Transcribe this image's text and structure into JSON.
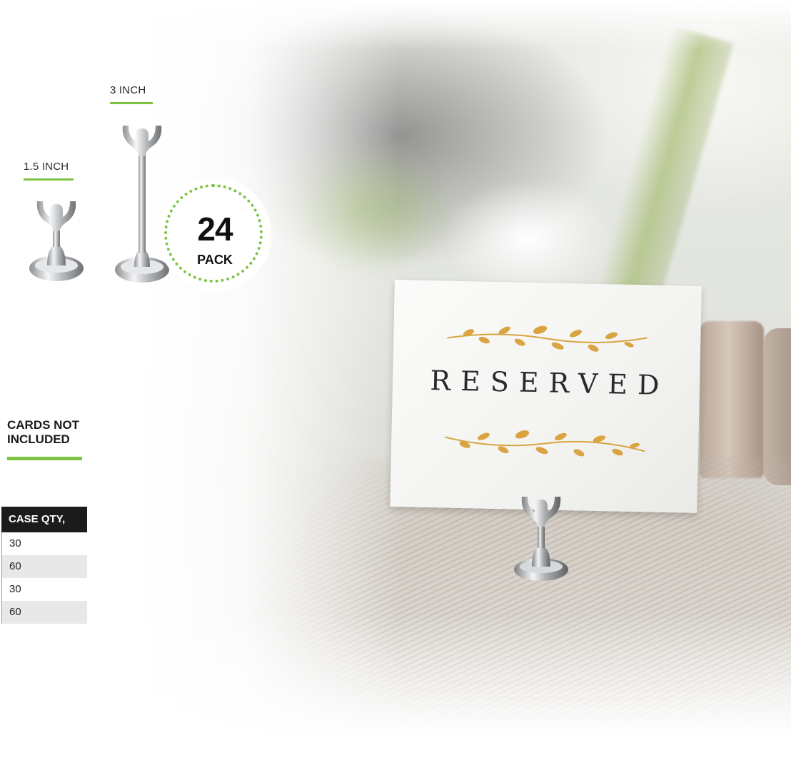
{
  "sizes": {
    "small_label": "1.5 INCH",
    "large_label": "3 INCH"
  },
  "badge": {
    "number": "24",
    "word": "PACK"
  },
  "note": {
    "line1": "CARDS NOT",
    "line2": "INCLUDED"
  },
  "table": {
    "header": "CASE QTY,",
    "rows": [
      "30",
      "60",
      "30",
      "60"
    ]
  },
  "card": {
    "word": "RESERVED"
  },
  "colors": {
    "accent_green": "#7dc242",
    "table_header": "#1b1b1b",
    "gold": "#d9a441"
  },
  "icons": {
    "small_holder": "chrome-card-holder-short",
    "tall_holder": "chrome-card-holder-tall"
  }
}
